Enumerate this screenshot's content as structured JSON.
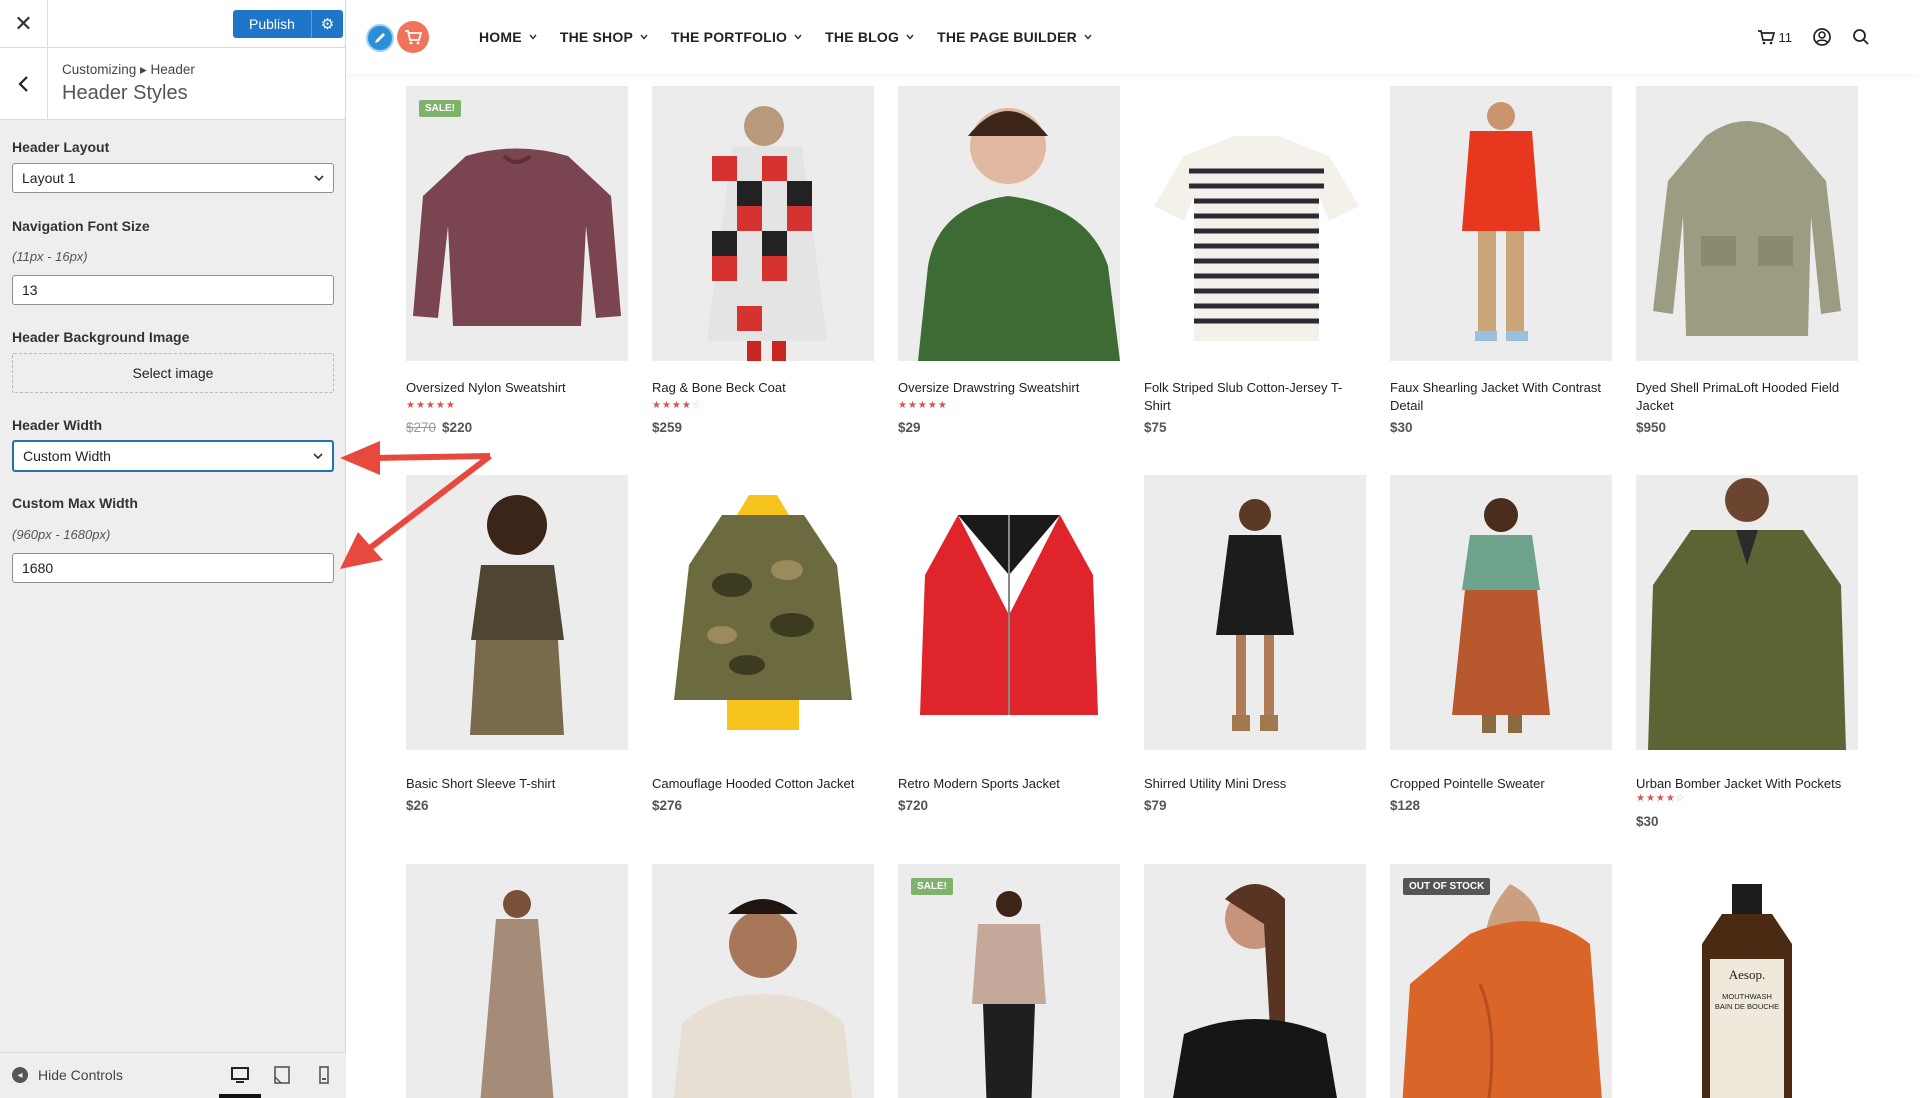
{
  "sidebar": {
    "close_label": "✕",
    "publish_label": "Publish",
    "breadcrumb": "Customizing ▸ Header",
    "section_title": "Header Styles",
    "controls": {
      "header_layout": {
        "label": "Header Layout",
        "value": "Layout 1"
      },
      "nav_font_size": {
        "label": "Navigation Font Size",
        "hint": "(11px - 16px)",
        "value": "13"
      },
      "bg_image": {
        "label": "Header Background Image",
        "button": "Select image"
      },
      "header_width": {
        "label": "Header Width",
        "value": "Custom Width"
      },
      "custom_max_width": {
        "label": "Custom Max Width",
        "hint": "(960px - 1680px)",
        "value": "1680"
      }
    },
    "footer": {
      "hide_controls": "Hide Controls"
    }
  },
  "site": {
    "nav": [
      "HOME",
      "THE SHOP",
      "THE PORTFOLIO",
      "THE BLOG",
      "THE PAGE BUILDER"
    ],
    "cart_count": "11",
    "products": [
      {
        "name": "Oversized Nylon Sweatshirt",
        "old_price": "$270",
        "price": "$220",
        "rating": 5,
        "badge": "SALE!",
        "image": "sweatshirt-maroon"
      },
      {
        "name": "Rag & Bone Beck Coat",
        "price": "$259",
        "rating": 4,
        "image": "plaid-coat"
      },
      {
        "name": "Oversize Drawstring Sweatshirt",
        "price": "$29",
        "rating": 5,
        "image": "green-sweatshirt"
      },
      {
        "name": "Folk Striped Slub Cotton-Jersey T-Shirt",
        "price": "$75",
        "image": "striped-tee"
      },
      {
        "name": "Faux Shearling Jacket With Contrast Detail",
        "price": "$30",
        "image": "red-jacket"
      },
      {
        "name": "Dyed Shell PrimaLoft Hooded Field Jacket",
        "price": "$950",
        "image": "field-jacket"
      },
      {
        "name": "Basic Short Sleeve T-shirt",
        "price": "$26",
        "image": "brown-tee"
      },
      {
        "name": "Camouflage Hooded Cotton Jacket",
        "price": "$276",
        "image": "camo-jacket"
      },
      {
        "name": "Retro Modern Sports Jacket",
        "price": "$720",
        "image": "sports-jacket"
      },
      {
        "name": "Shirred Utility Mini Dress",
        "price": "$79",
        "image": "black-dress"
      },
      {
        "name": "Cropped Pointelle Sweater",
        "price": "$128",
        "image": "pointelle-sweater"
      },
      {
        "name": "Urban Bomber Jacket With Pockets",
        "price": "$30",
        "rating": 4,
        "image": "bomber-jacket"
      },
      {
        "badge": "",
        "image": "beige-dress"
      },
      {
        "badge": "",
        "image": "cream-hoodie"
      },
      {
        "badge": "SALE!",
        "image": "pink-tee"
      },
      {
        "badge": "",
        "image": "black-top"
      },
      {
        "badge": "OUT OF STOCK",
        "image": "orange-blouse"
      },
      {
        "badge": "",
        "image": "aesop-bottle",
        "bottle_text": [
          "Aesop.",
          "MOUTHWASH",
          "BAIN DE BOUCHE"
        ]
      }
    ]
  },
  "colors": {
    "publish": "#1f75c7",
    "accent_orange": "#f0735a",
    "accent_blue": "#2a8fd8",
    "arrow": "#e8493f",
    "star": "#d9534f",
    "sale": "#7fb36c"
  }
}
